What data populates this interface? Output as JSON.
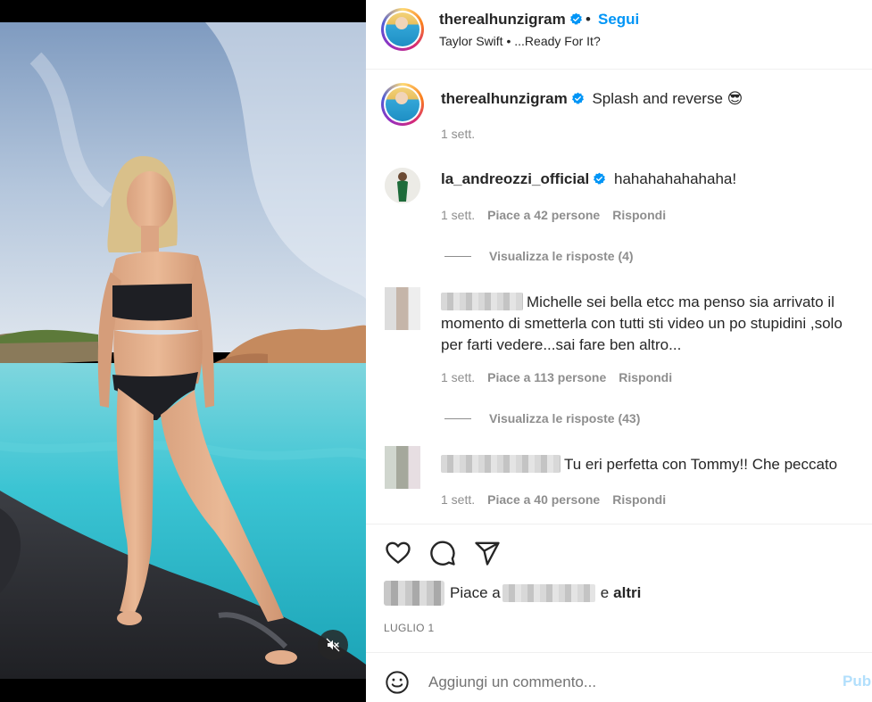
{
  "post": {
    "username": "therealhunzigram",
    "separator": "•",
    "follow_label": "Segui",
    "music": "Taylor Swift • ...Ready For It?"
  },
  "caption": {
    "username": "therealhunzigram",
    "text": "Splash and reverse 😎",
    "time": "1 sett."
  },
  "comments": [
    {
      "username": "la_andreozzi_official",
      "text": "hahahahahahaha!",
      "time": "1 sett.",
      "likes": "Piace a 42 persone",
      "reply": "Rispondi",
      "view_replies": "Visualizza le risposte (4)"
    },
    {
      "username": "",
      "text_line1": "Michelle sei bella etcc ma penso sia arrivato il",
      "text_line2": "momento di smetterla con tutti sti video un po stupidini ,solo",
      "text_line3": "per farti vedere...sai fare ben altro...",
      "time": "1 sett.",
      "likes": "Piace a 113 persone",
      "reply": "Rispondi",
      "view_replies": "Visualizza le risposte (43)"
    },
    {
      "username": "",
      "text": "Tu eri perfetta con Tommy!! Che peccato",
      "time": "1 sett.",
      "likes": "Piace a 40 persone",
      "reply": "Rispondi"
    }
  ],
  "likes_summary": {
    "prefix": "Piace a",
    "suffix": "e",
    "others": "altri"
  },
  "date": "LUGLIO 1",
  "add_comment": {
    "placeholder": "Aggiungi un commento...",
    "publish_label": "Pub"
  },
  "icons": {
    "verified": "verified-badge-icon",
    "like": "heart-icon",
    "comment": "comment-icon",
    "share": "paper-plane-icon",
    "emoji": "smiley-icon",
    "mute": "speaker-muted-icon"
  },
  "colors": {
    "accent": "#0095f6",
    "publish_disabled": "#b2dffc",
    "muted_text": "#8e8e8e"
  }
}
